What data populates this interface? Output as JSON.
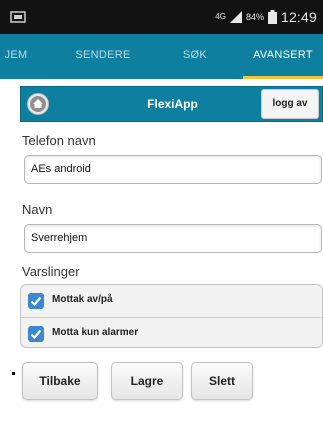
{
  "status_bar": {
    "network": "4G",
    "battery": "84%",
    "time": "12:49"
  },
  "tabs": [
    {
      "label": "JEM",
      "active": false
    },
    {
      "label": "SENDERE",
      "active": false
    },
    {
      "label": "SØK",
      "active": false
    },
    {
      "label": "AVANSERT",
      "active": true
    }
  ],
  "app": {
    "title": "FlexiApp",
    "logout_label": "logg av"
  },
  "form": {
    "phone_label": "Telefon navn",
    "phone_value": "AEs android",
    "name_label": "Navn",
    "name_value": "Sverrehjem",
    "notifications_label": "Varslinger",
    "checkboxes": [
      {
        "label": "Mottak av/på",
        "checked": true
      },
      {
        "label": "Motta kun alarmer",
        "checked": true
      }
    ]
  },
  "buttons": {
    "back": "Tilbake",
    "save": "Lagre",
    "delete": "Slett"
  },
  "colors": {
    "tab_bar": "#0f7fa0",
    "tab_indicator": "#f5c33b",
    "checkbox": "#3a89cf"
  }
}
